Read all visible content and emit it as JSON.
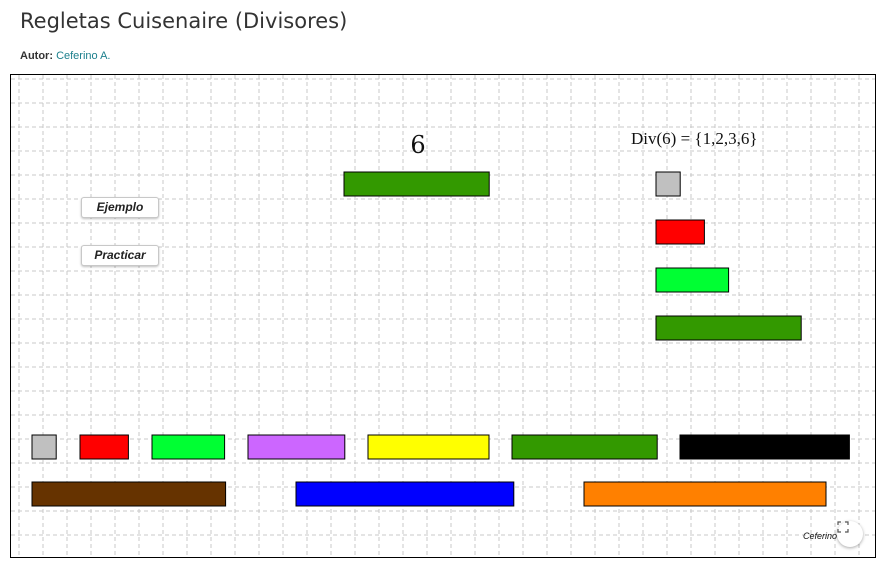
{
  "header": {
    "title": "Regletas Cuisenaire (Divisores)",
    "author_label": "Autor:",
    "author_name": "Ceferino A."
  },
  "applet": {
    "buttons": {
      "ejemplo": "Ejemplo",
      "practicar": "Practicar"
    },
    "target_number": "6",
    "divisors_text": "Div(6) = {1,2,3,6}",
    "credit": "Ceferino",
    "fullscreen_icon": "expand-icon"
  },
  "rods": {
    "palette": [
      {
        "value": 1,
        "color": "#c0c0c0"
      },
      {
        "value": 2,
        "color": "#ff0000"
      },
      {
        "value": 3,
        "color": "#00ff33"
      },
      {
        "value": 4,
        "color": "#cc66ff"
      },
      {
        "value": 5,
        "color": "#ffff00"
      },
      {
        "value": 6,
        "color": "#339900"
      },
      {
        "value": 7,
        "color": "#000000"
      },
      {
        "value": 8,
        "color": "#663300"
      },
      {
        "value": 9,
        "color": "#0000ff"
      },
      {
        "value": 10,
        "color": "#ff8000"
      }
    ],
    "target_rod": {
      "value": 6,
      "color": "#339900"
    },
    "divisor_rods": [
      {
        "value": 1,
        "color": "#c0c0c0"
      },
      {
        "value": 2,
        "color": "#ff0000"
      },
      {
        "value": 3,
        "color": "#00ff33"
      },
      {
        "value": 6,
        "color": "#339900"
      }
    ]
  }
}
